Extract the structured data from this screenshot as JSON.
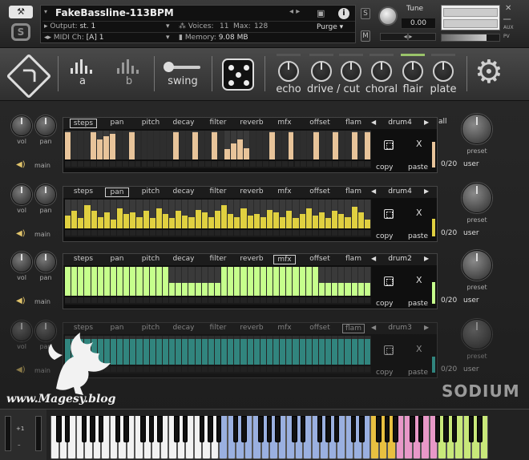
{
  "header": {
    "instrument_name": "FakeBassline-113BPM",
    "output_label": "Output:",
    "output_value": "st. 1",
    "voices_label": "Voices:",
    "voices_value": "11",
    "max_label": "Max:",
    "max_value": "128",
    "midi_label": "MIDI Ch:",
    "midi_value": "[A] 1",
    "memory_label": "Memory:",
    "memory_value": "9.08 MB",
    "purge_label": "Purge",
    "s_label": "S",
    "m_label": "M",
    "tune_label": "Tune",
    "tune_value": "0.00",
    "pan_value": "◂|▸",
    "aux_label": "AUX",
    "pv_label": "PV"
  },
  "toolbar": {
    "pattern_a": "a",
    "pattern_b": "b",
    "swing": "swing",
    "fx": [
      "echo",
      "drive / cut",
      "choral",
      "flair",
      "plate"
    ]
  },
  "lanes": [
    {
      "vol": "vol",
      "pan": "pan",
      "main": "main",
      "tabs": [
        "steps",
        "pan",
        "pitch",
        "decay",
        "filter",
        "reverb",
        "mfx",
        "offset",
        "flam"
      ],
      "selected_tab": 0,
      "pattern": "drum4",
      "all": "all",
      "copy": "copy",
      "paste": "paste",
      "x": "X",
      "preset": "preset",
      "count": "0/20",
      "user": "user",
      "color": "#e8c49a",
      "steps": [
        0.95,
        0,
        0,
        0,
        0.95,
        0.7,
        0.8,
        0.9,
        0,
        0,
        0.95,
        0,
        0,
        0,
        0,
        0,
        0,
        0.95,
        0,
        0,
        0.95,
        0,
        0,
        0.95,
        0,
        0.35,
        0.55,
        0.7,
        0.4,
        0,
        0,
        0,
        0.95,
        0,
        0,
        0.95,
        0,
        0,
        0,
        0.95,
        0,
        0,
        0.95,
        0,
        0,
        0.95,
        0,
        0.95
      ],
      "meter": 0.9
    },
    {
      "vol": "vol",
      "pan": "pan",
      "main": "main",
      "tabs": [
        "steps",
        "pan",
        "pitch",
        "decay",
        "filter",
        "reverb",
        "mfx",
        "offset",
        "flam"
      ],
      "selected_tab": 1,
      "pattern": "drum4",
      "all": "",
      "copy": "copy",
      "paste": "paste",
      "x": "X",
      "preset": "preset",
      "count": "0/20",
      "user": "user",
      "color": "#e0d040",
      "steps": [
        0.45,
        0.6,
        0.35,
        0.8,
        0.6,
        0.4,
        0.55,
        0.3,
        0.7,
        0.5,
        0.55,
        0.4,
        0.6,
        0.35,
        0.7,
        0.5,
        0.35,
        0.6,
        0.45,
        0.4,
        0.65,
        0.55,
        0.4,
        0.6,
        0.8,
        0.5,
        0.4,
        0.7,
        0.45,
        0.5,
        0.4,
        0.65,
        0.55,
        0.4,
        0.6,
        0.35,
        0.5,
        0.7,
        0.45,
        0.55,
        0.35,
        0.6,
        0.5,
        0.4,
        0.75,
        0.55,
        0.3
      ],
      "meter": 0.6
    },
    {
      "vol": "vol",
      "pan": "pan",
      "main": "main",
      "tabs": [
        "steps",
        "pan",
        "pitch",
        "decay",
        "filter",
        "reverb",
        "mfx",
        "offset",
        "flam"
      ],
      "selected_tab": 6,
      "pattern": "drum2",
      "all": "",
      "copy": "copy",
      "paste": "paste",
      "x": "X",
      "preset": "preset",
      "count": "0/20",
      "user": "user",
      "color": "#c6ff8c",
      "steps": [
        1,
        1,
        1,
        1,
        1,
        1,
        1,
        1,
        1,
        1,
        1,
        1,
        1,
        1,
        1,
        1,
        0.45,
        0.45,
        0.45,
        0.45,
        0.45,
        0.45,
        0.45,
        0.45,
        1,
        1,
        1,
        1,
        1,
        1,
        1,
        1,
        1,
        1,
        1,
        1,
        1,
        1,
        1,
        0.45,
        0.45,
        0.45,
        0.45,
        0.45,
        0.45,
        0.45,
        0.45
      ],
      "meter": 0.75
    },
    {
      "vol": "vol",
      "pan": "pan",
      "main": "main",
      "tabs": [
        "steps",
        "pan",
        "pitch",
        "decay",
        "filter",
        "reverb",
        "mfx",
        "offset",
        "flam"
      ],
      "selected_tab": 8,
      "pattern": "drum3",
      "all": "",
      "copy": "copy",
      "paste": "paste",
      "x": "X",
      "preset": "preset",
      "count": "0/20",
      "user": "user",
      "color": "#3fd8cc",
      "steps": [
        0.9,
        0.9,
        0.9,
        0.9,
        0.9,
        0.9,
        0.9,
        0.9,
        0.9,
        0.9,
        0.9,
        0.9,
        0.9,
        0.9,
        0.9,
        0.9,
        0.9,
        0.9,
        0.9,
        0.9,
        0.9,
        0.9,
        0.9,
        0.9,
        0.9,
        0.9,
        0.9,
        0.9,
        0.9,
        0.9,
        0.9,
        0.9,
        0.9,
        0.9,
        0.9,
        0.9,
        0.9,
        0.9,
        0.9,
        0.9,
        0.9,
        0.9,
        0.9,
        0.9,
        0.9,
        0.9,
        0.9
      ],
      "meter": 0.55
    }
  ],
  "brand": "SODIUM",
  "watermark": "www.Magesy.blog",
  "keyboard": {
    "octave_label": "+1",
    "minus_label": "–"
  }
}
